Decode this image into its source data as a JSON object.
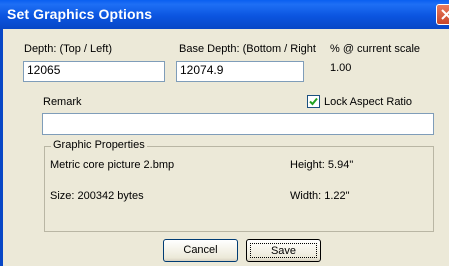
{
  "window": {
    "title": "Set Graphics Options",
    "close_icon": "close-icon"
  },
  "fields": {
    "depth_top_label": "Depth: (Top / Left)",
    "depth_top_value": "12065",
    "base_depth_label": "Base Depth: (Bottom / Right",
    "base_depth_value": "12074.9",
    "scale_label": "% @ current scale",
    "scale_value": "1.00",
    "remark_label": "Remark",
    "remark_value": "",
    "lock_aspect_label": "Lock Aspect Ratio",
    "lock_aspect_checked": true
  },
  "graphic_properties": {
    "title": "Graphic Properties",
    "filename": "Metric core picture 2.bmp",
    "size": "Size: 200342 bytes",
    "height": "Height: 5.94\"",
    "width": "Width: 1.22\""
  },
  "buttons": {
    "cancel_label": "Cancel",
    "save_label": "Save"
  },
  "colors": {
    "titlebar": "#0b55e0",
    "dialog_bg": "#ece9d8",
    "input_border": "#7f9db9"
  }
}
